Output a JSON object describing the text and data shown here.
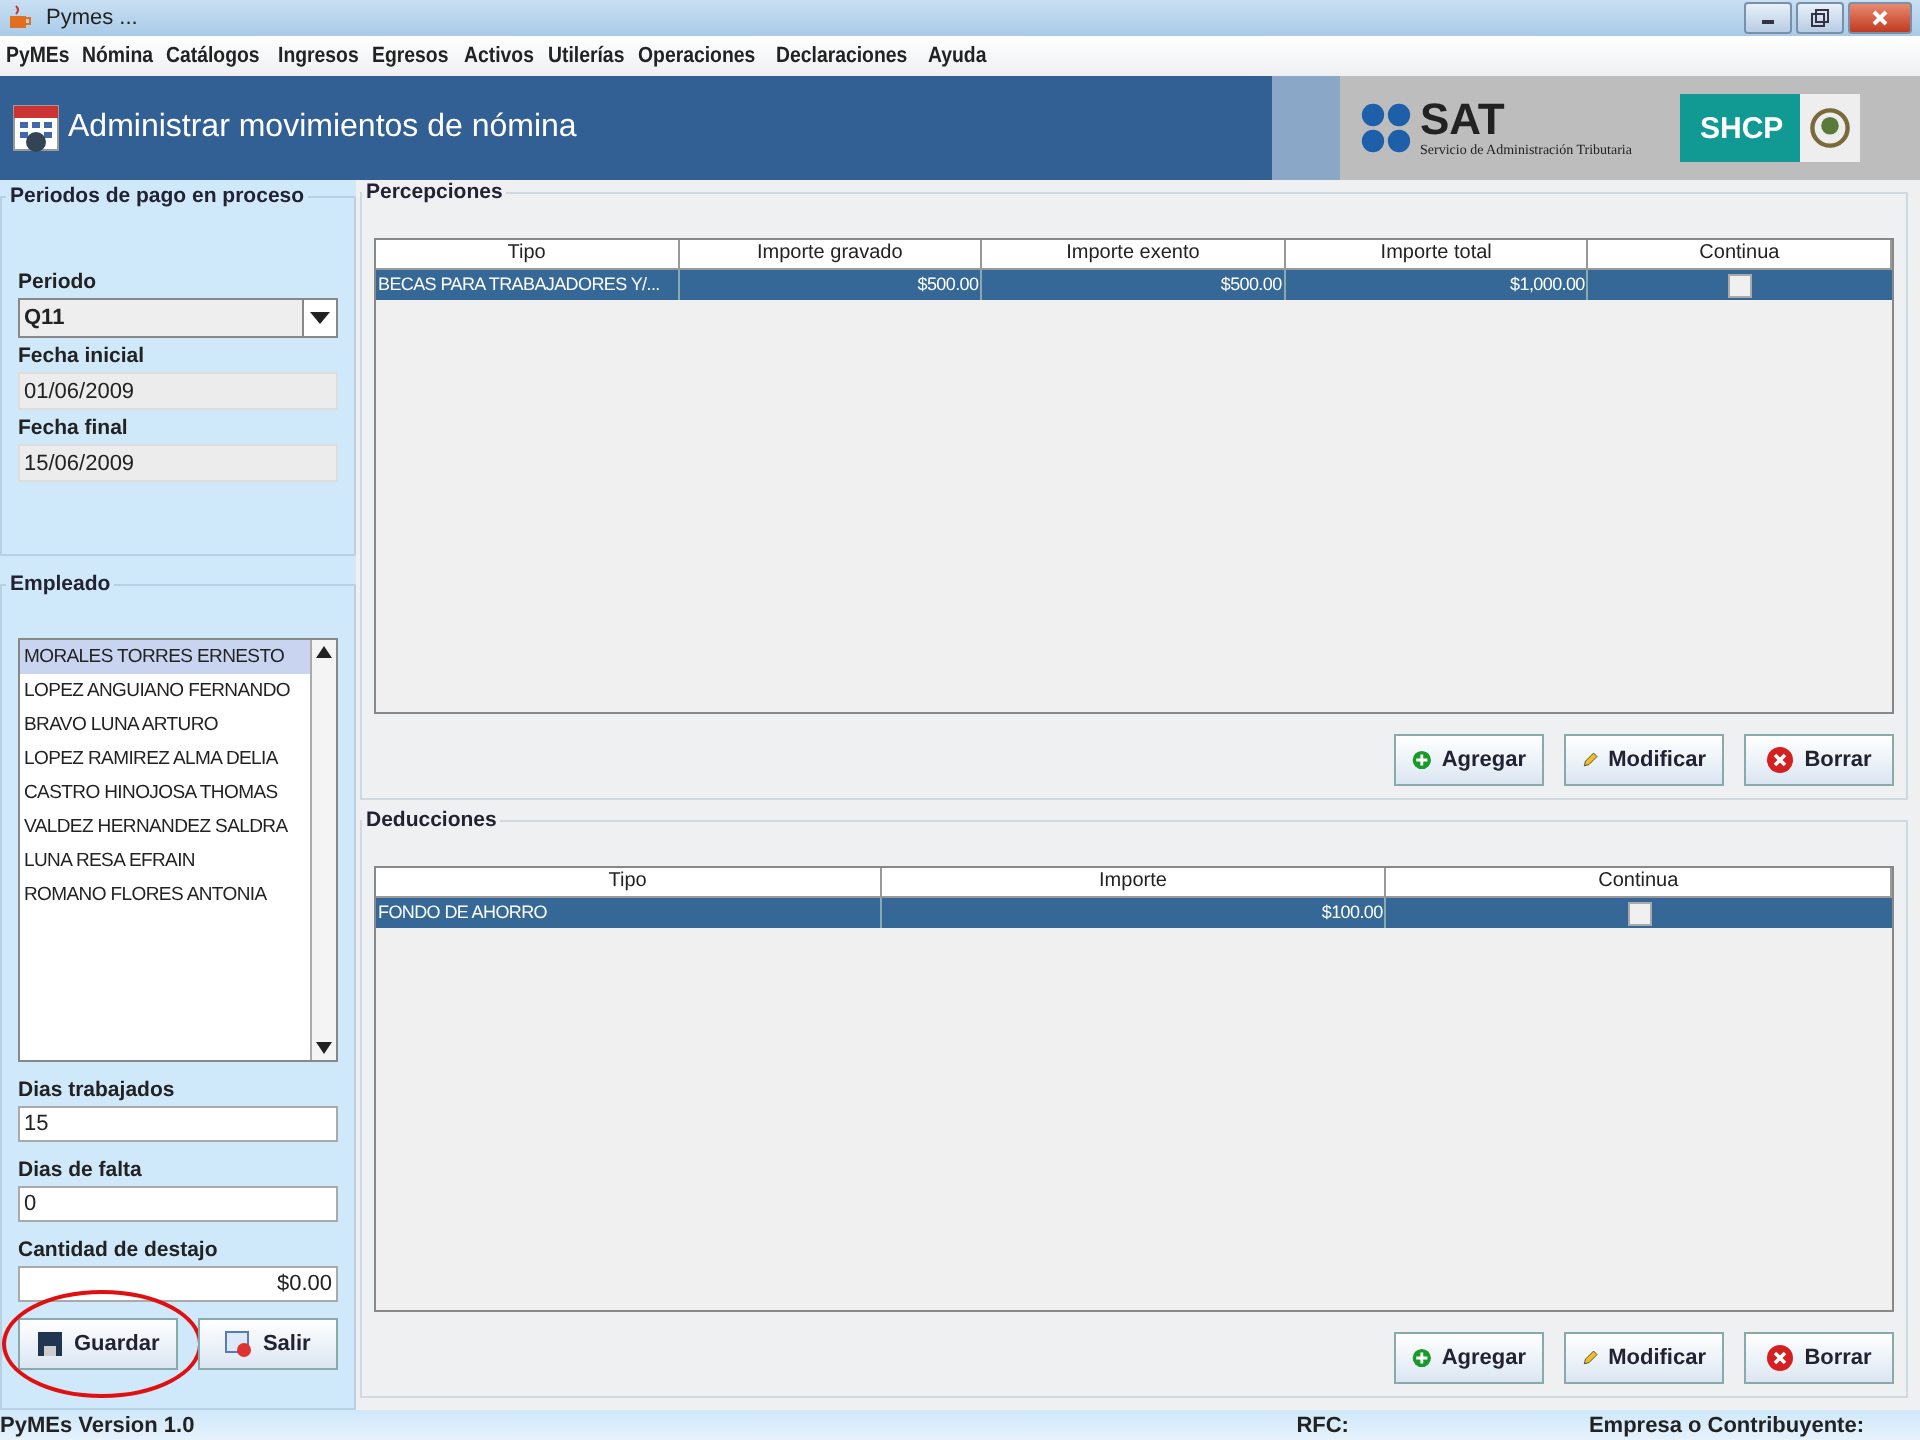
{
  "window": {
    "title": "Pymes ..."
  },
  "menu": [
    "PyMEs",
    "Nómina",
    "Catálogos",
    "Ingresos",
    "Egresos",
    "Activos",
    "Utilerías",
    "Operaciones",
    "Declaraciones",
    "Ayuda"
  ],
  "banner": {
    "title": "Administrar movimientos de nómina",
    "sat": "SAT",
    "sat_subtitle": "Servicio de Administración Tributaria",
    "shcp": "SHCP"
  },
  "periods": {
    "title": "Periodos de pago en proceso",
    "period_label": "Periodo",
    "period_value": "Q11",
    "start_label": "Fecha inicial",
    "start_value": "01/06/2009",
    "end_label": "Fecha final",
    "end_value": "15/06/2009"
  },
  "employees": {
    "title": "Empleado",
    "items": [
      {
        "name": "MORALES TORRES ERNESTO",
        "selected": true
      },
      {
        "name": "LOPEZ ANGUIANO FERNANDO",
        "selected": false
      },
      {
        "name": "BRAVO LUNA ARTURO",
        "selected": false
      },
      {
        "name": "LOPEZ RAMIREZ ALMA DELIA",
        "selected": false
      },
      {
        "name": "CASTRO HINOJOSA THOMAS",
        "selected": false
      },
      {
        "name": "VALDEZ HERNANDEZ SALDRA",
        "selected": false
      },
      {
        "name": "LUNA RESA EFRAIN",
        "selected": false
      },
      {
        "name": "ROMANO FLORES ANTONIA",
        "selected": false
      }
    ],
    "fields": [
      {
        "label": "Dias trabajados",
        "value": "15"
      },
      {
        "label": "Dias de falta",
        "value": "0"
      },
      {
        "label": "Cantidad de destajo",
        "value": "$0.00"
      }
    ],
    "buttons": [
      {
        "label": "Guardar",
        "kind": "save",
        "highlighted": true
      },
      {
        "label": "Salir",
        "kind": "exit",
        "highlighted": false
      }
    ]
  },
  "sections": [
    {
      "title": "Percepciones",
      "columns": [
        "Tipo",
        "Importe gravado",
        "Importe exento",
        "Importe total",
        "Continua"
      ],
      "rows": [
        {
          "cells": [
            "BECAS PARA TRABAJADORES Y/...",
            "$500.00",
            "$500.00",
            "$1,000.00"
          ],
          "continua": false,
          "selected": true
        }
      ],
      "buttons": [
        {
          "label": "Agregar",
          "kind": "add"
        },
        {
          "label": "Modificar",
          "kind": "edit"
        },
        {
          "label": "Borrar",
          "kind": "delete"
        }
      ]
    },
    {
      "title": "Deducciones",
      "columns": [
        "Tipo",
        "Importe",
        "Continua"
      ],
      "rows": [
        {
          "cells": [
            "FONDO DE AHORRO",
            "$100.00"
          ],
          "continua": false,
          "selected": true
        }
      ],
      "buttons": [
        {
          "label": "Agregar",
          "kind": "add"
        },
        {
          "label": "Modificar",
          "kind": "edit"
        },
        {
          "label": "Borrar",
          "kind": "delete"
        }
      ]
    }
  ],
  "status_bar": {
    "version": "PyMEs Version 1.0",
    "rfc_label": "RFC:",
    "company_label": "Empresa o Contribuyente:"
  }
}
